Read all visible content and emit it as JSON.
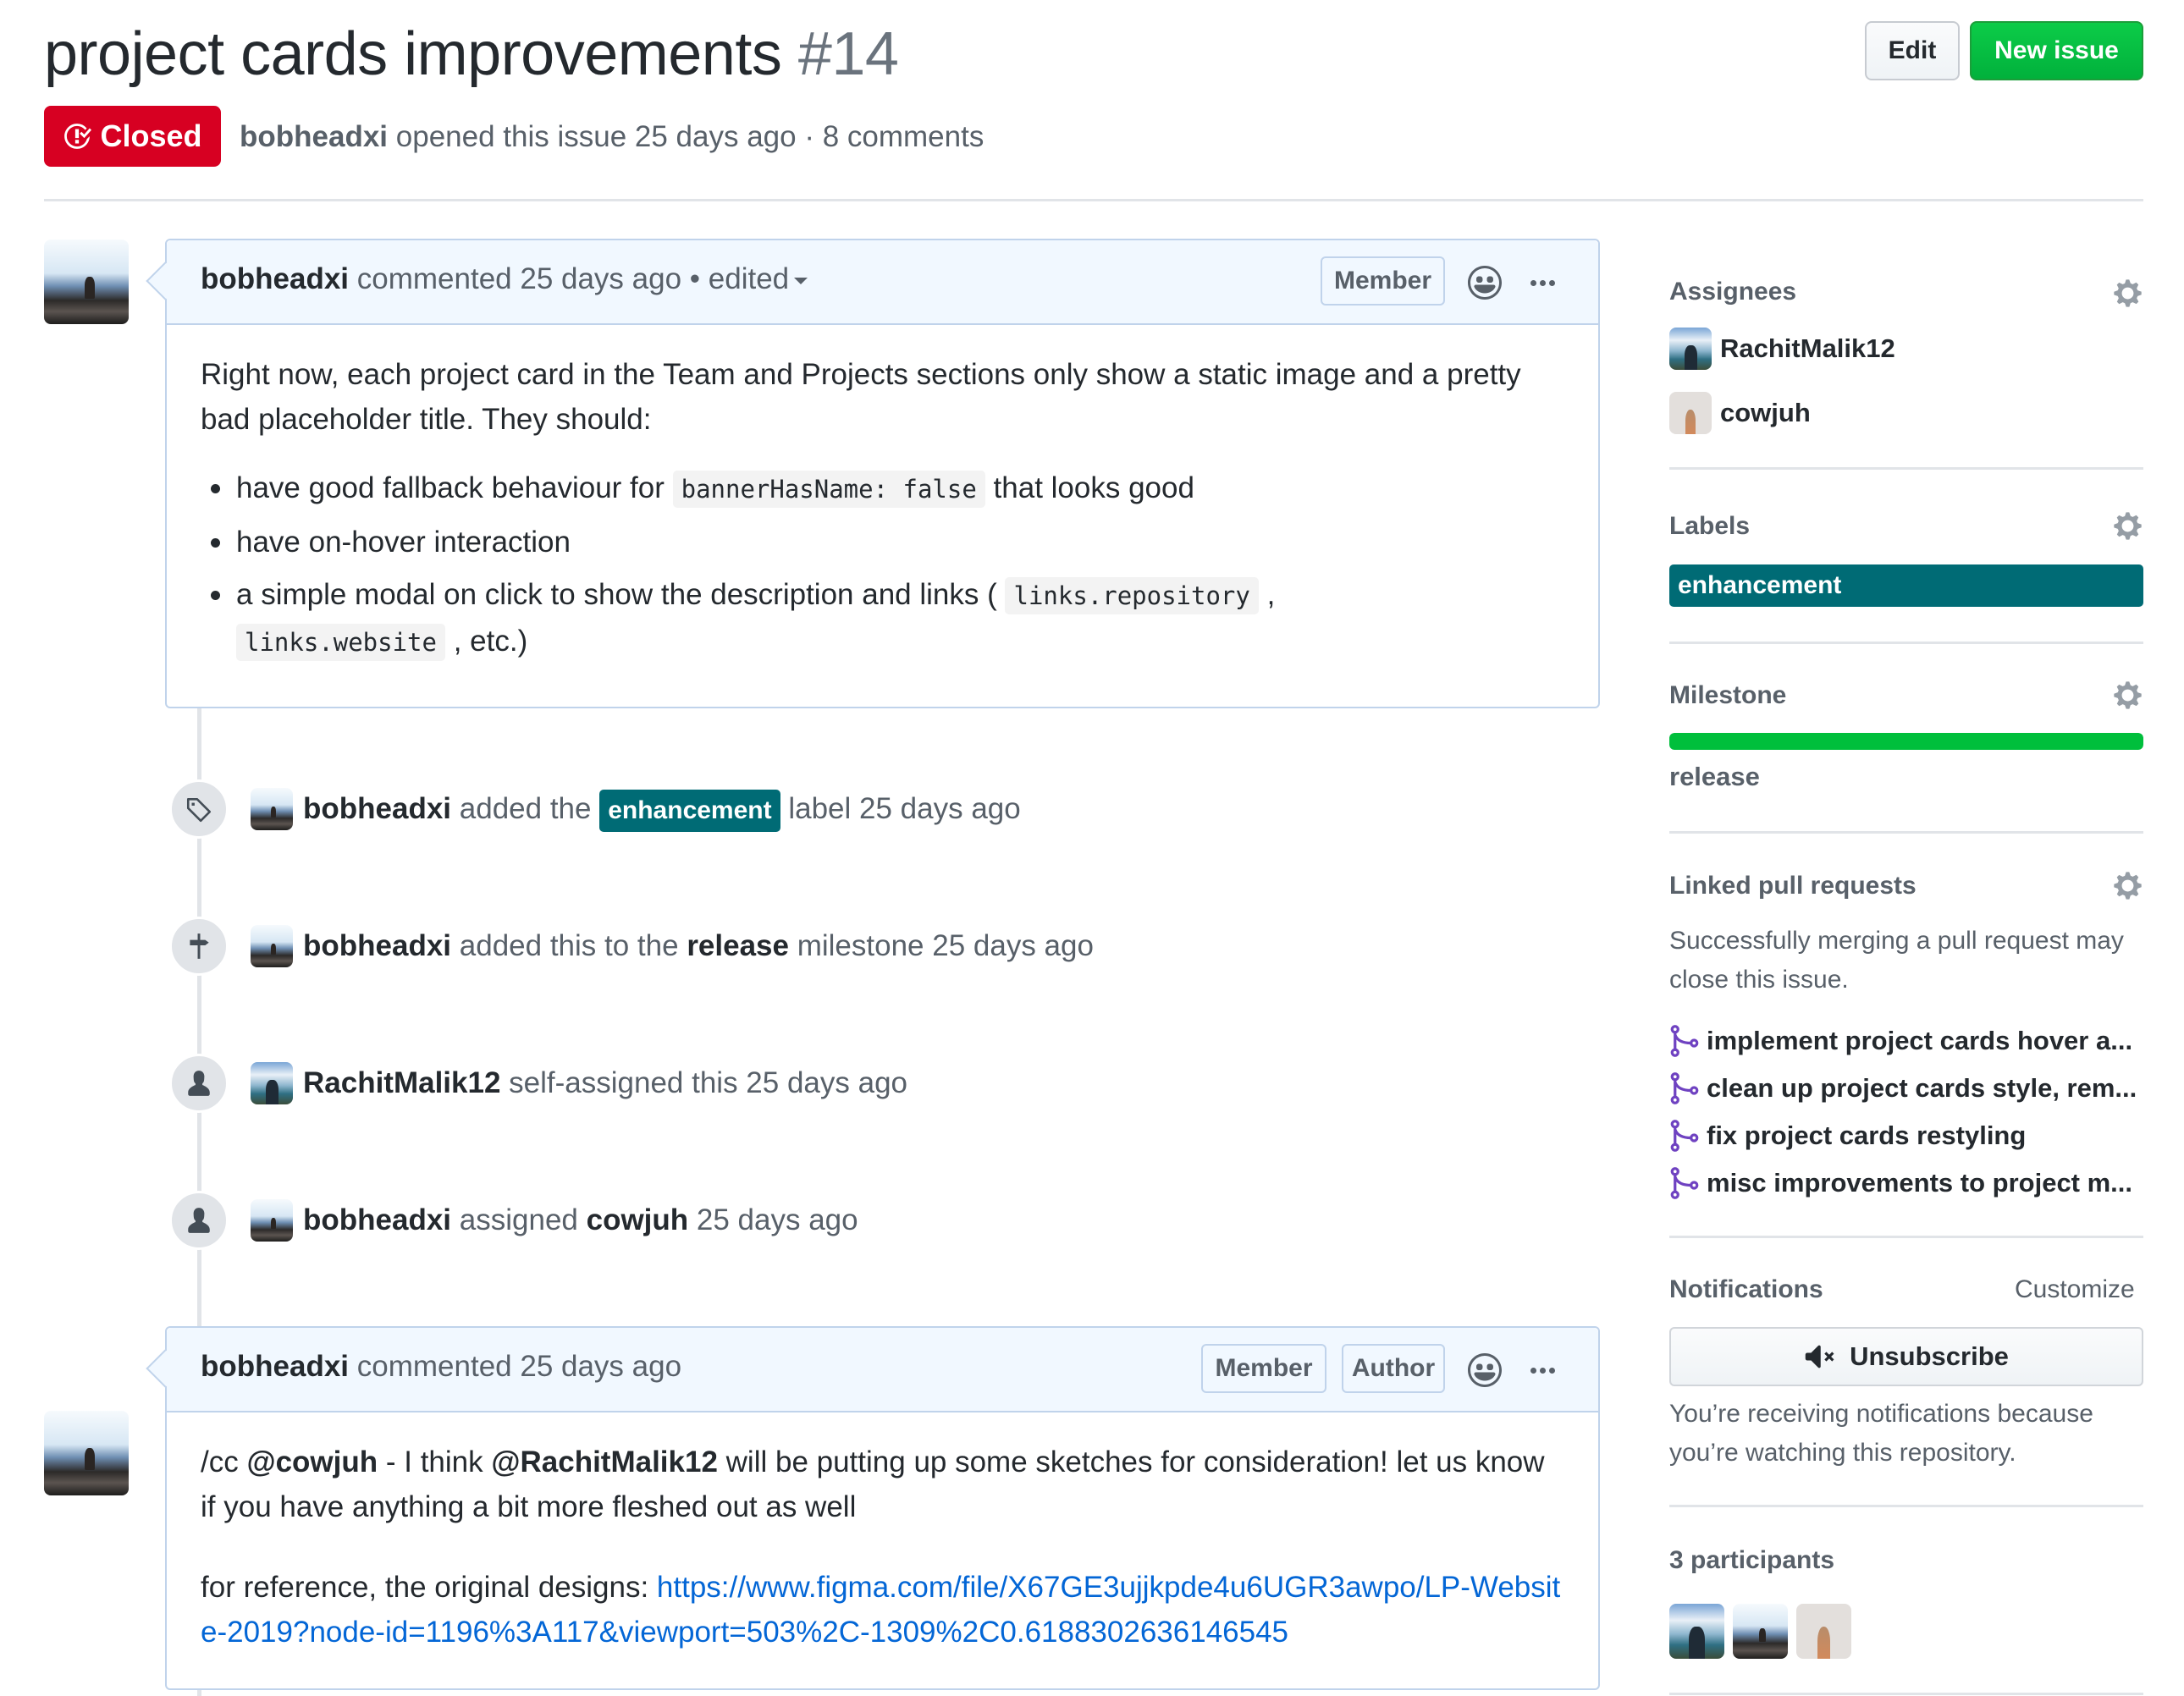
{
  "issue": {
    "title": "project cards improvements",
    "number": "#14",
    "state": "Closed",
    "author": "bobheadxi",
    "opened_text": "opened this issue 25 days ago · 8 comments"
  },
  "header_actions": {
    "edit_label": "Edit",
    "new_issue_label": "New issue"
  },
  "colors": {
    "closed_red": "#d70022",
    "label_teal": "#006b75",
    "primary_green": "#01b13c",
    "link_blue": "#0366d6",
    "merged_purple": "#6f42c1"
  },
  "comments": [
    {
      "author": "bobheadxi",
      "meta": "commented 25 days ago • edited",
      "badges": [
        "Member"
      ],
      "body": {
        "intro": "Right now, each project card in the Team and Projects sections only show a static image and a pretty bad placeholder title. They should:",
        "items": [
          {
            "pre": "have good fallback behaviour for ",
            "code": "bannerHasName: false",
            "post": " that looks good"
          },
          {
            "pre": "have on-hover interaction"
          },
          {
            "pre": "a simple modal on click to show the description and links ( ",
            "code": "links.repository",
            "mid": " , ",
            "code2": "links.website",
            "post": " , etc.)"
          }
        ]
      }
    },
    {
      "author": "bobheadxi",
      "meta": "commented 25 days ago",
      "badges": [
        "Member",
        "Author"
      ],
      "body": {
        "p1_pre": "/cc ",
        "mention1": "@cowjuh",
        "p1_mid": " - I think ",
        "mention2": "@RachitMalik12",
        "p1_post": " will be putting up some sketches for consideration! let us know if you have anything a bit more fleshed out as well",
        "p2_pre": "for reference, the original designs: ",
        "link": "https://www.figma.com/file/X67GE3ujjkpde4u6UGR3awpo/LP-Website-2019?node-id=1196%3A117&viewport=503%2C-1309%2C0.6188302636146545"
      }
    }
  ],
  "timeline": [
    {
      "icon": "tag-icon",
      "actor": "bobheadxi",
      "pre": "added the",
      "label": "enhancement",
      "post": "label 25 days ago"
    },
    {
      "icon": "milestone-icon",
      "actor": "bobheadxi",
      "pre": "added this to the",
      "bold": "release",
      "post": "milestone 25 days ago"
    },
    {
      "icon": "person-icon",
      "actor": "RachitMalik12",
      "pre": "self-assigned this 25 days ago"
    },
    {
      "icon": "person-icon",
      "actor": "bobheadxi",
      "pre": "assigned",
      "bold": "cowjuh",
      "post": "25 days ago"
    }
  ],
  "sidebar": {
    "assignees": {
      "heading": "Assignees",
      "users": [
        "RachitMalik12",
        "cowjuh"
      ]
    },
    "labels": {
      "heading": "Labels",
      "items": [
        "enhancement"
      ]
    },
    "milestone": {
      "heading": "Milestone",
      "name": "release",
      "progress_percent": 100
    },
    "linked_prs": {
      "heading": "Linked pull requests",
      "note": "Successfully merging a pull request may close this issue.",
      "items": [
        "implement project cards hover a...",
        "clean up project cards style, rem...",
        "fix project cards restyling",
        "misc improvements to project m..."
      ]
    },
    "notifications": {
      "heading": "Notifications",
      "customize_label": "Customize",
      "unsubscribe_label": "Unsubscribe",
      "note": "You’re receiving notifications because you’re watching this repository."
    },
    "participants": {
      "heading": "3 participants",
      "users": [
        "RachitMalik12",
        "bobheadxi",
        "cowjuh"
      ]
    }
  }
}
